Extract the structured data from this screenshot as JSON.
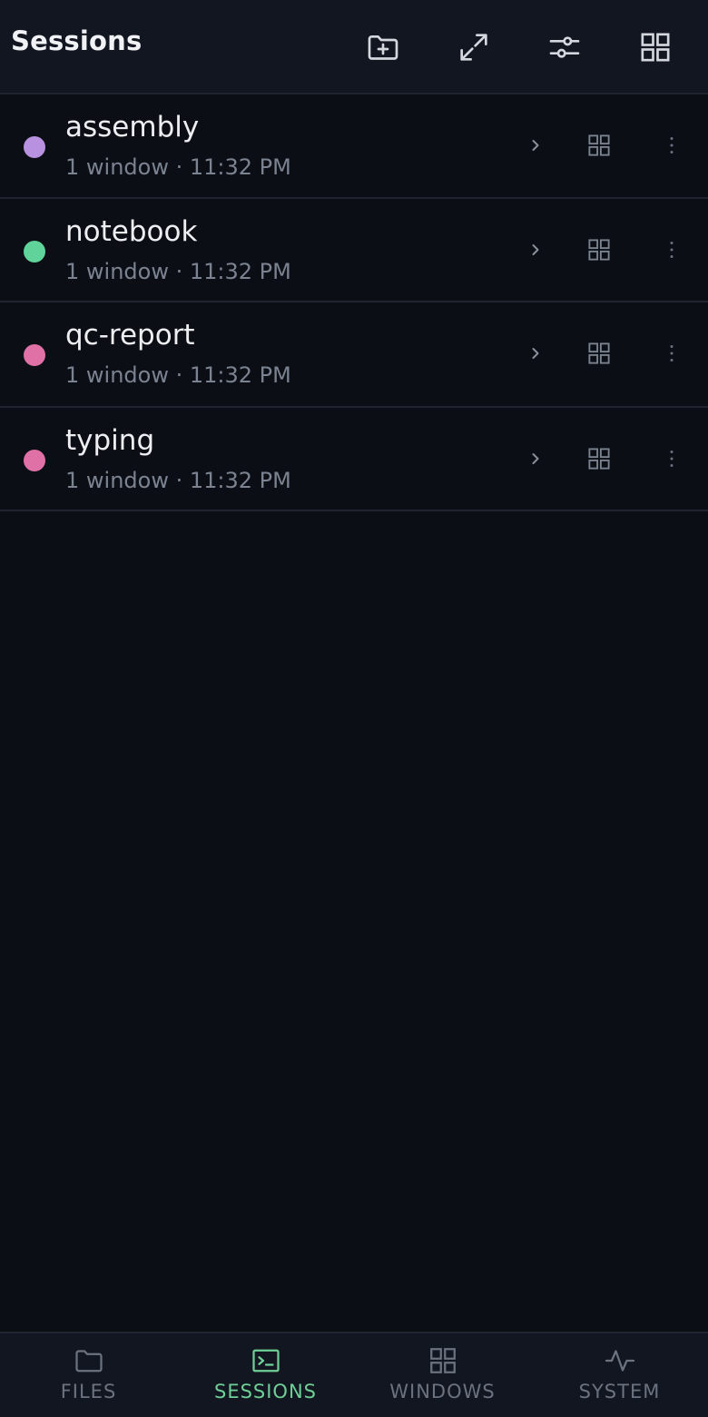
{
  "header": {
    "title": "Sessions",
    "actions": [
      {
        "name": "new-session",
        "icon": "folder-plus-icon"
      },
      {
        "name": "expand",
        "icon": "expand-icon"
      },
      {
        "name": "filters",
        "icon": "sliders-icon"
      },
      {
        "name": "grid-view",
        "icon": "grid-icon"
      }
    ]
  },
  "sessions": [
    {
      "name": "assembly",
      "meta": "1 window · 11:32 PM",
      "color": "#b892e0"
    },
    {
      "name": "notebook",
      "meta": "1 window · 11:32 PM",
      "color": "#5fd39a"
    },
    {
      "name": "qc-report",
      "meta": "1 window · 11:32 PM",
      "color": "#e071a6"
    },
    {
      "name": "typing",
      "meta": "1 window · 11:32 PM",
      "color": "#e071a6"
    }
  ],
  "nav": {
    "active": "sessions",
    "items": [
      {
        "id": "files",
        "label": "FILES",
        "icon": "folder-icon"
      },
      {
        "id": "sessions",
        "label": "SESSIONS",
        "icon": "terminal-icon"
      },
      {
        "id": "windows",
        "label": "WINDOWS",
        "icon": "windows-grid-icon"
      },
      {
        "id": "system",
        "label": "SYSTEM",
        "icon": "activity-icon"
      }
    ]
  },
  "colors": {
    "background": "#0b0e15",
    "surface": "#121620",
    "accent": "#6fcf97",
    "muted": "#7c8390"
  }
}
